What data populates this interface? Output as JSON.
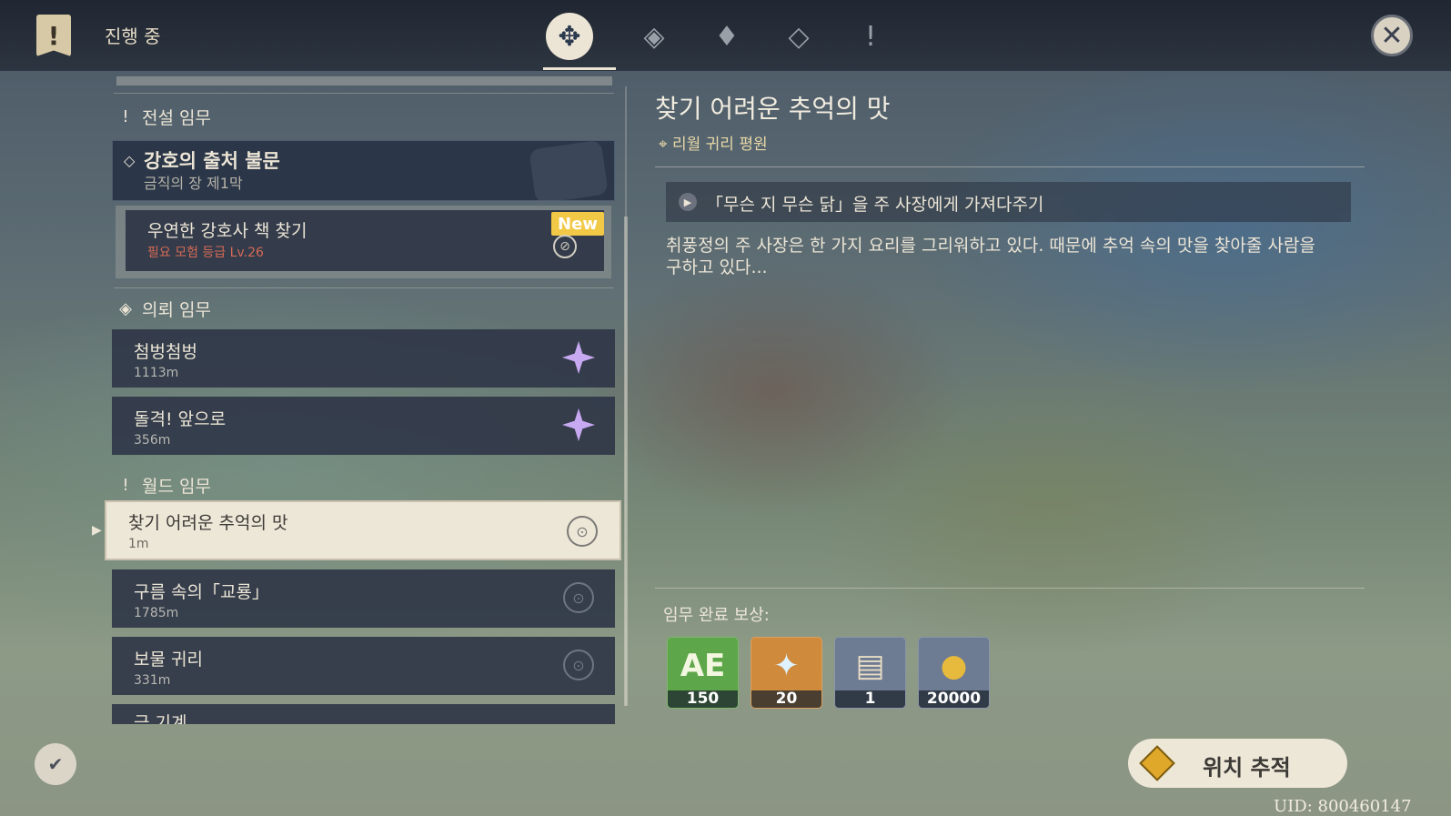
{
  "header": {
    "title": "진행 중",
    "tabs": [
      "all-quests",
      "archon-quests",
      "story-quests",
      "commission-quests",
      "world-quests"
    ]
  },
  "left": {
    "legend_category": "전설 임무",
    "legend_quest": {
      "title": "강호의 출처 불문",
      "subtitle": "금직의 장 제1막"
    },
    "legend_sub": {
      "title": "우연한 강호사 책 찾기",
      "requirement": "필요 모험 등급 Lv.26",
      "badge": "New"
    },
    "commission_category": "의뢰 임무",
    "commissions": [
      {
        "title": "첨벙첨벙",
        "dist": "1113m"
      },
      {
        "title": "돌격! 앞으로",
        "dist": "356m"
      }
    ],
    "world_category": "월드 임무",
    "selected": {
      "title": "찾기 어려운 추억의 맛",
      "dist": "1m"
    },
    "world": [
      {
        "title": "구름 속의「교룡」",
        "dist": "1785m"
      },
      {
        "title": "보물 귀리",
        "dist": "331m"
      },
      {
        "title": "극 기계",
        "dist": ""
      }
    ]
  },
  "detail": {
    "title": "찾기 어려운 추억의 맛",
    "location": "리월 귀리 평원",
    "objective": "「무슨 지 무슨 닭」을 주 사장에게 가져다주기",
    "description": "취풍정의 주 사장은 한 가지 요리를 그리워하고 있다. 때문에 추억 속의 맛을 찾아줄 사람을 구하고 있다...",
    "rewards_label": "임무 완료 보상:",
    "rewards": [
      {
        "name": "adventure-exp",
        "count": "150",
        "color": "#5ea64a"
      },
      {
        "name": "primogem",
        "count": "20",
        "color": "#d08a3c"
      },
      {
        "name": "recipe",
        "count": "1",
        "color": "#6d7b93"
      },
      {
        "name": "mora",
        "count": "20000",
        "color": "#6d7b93"
      }
    ],
    "track_button": "위치 추적"
  },
  "uid": "UID: 800460147"
}
